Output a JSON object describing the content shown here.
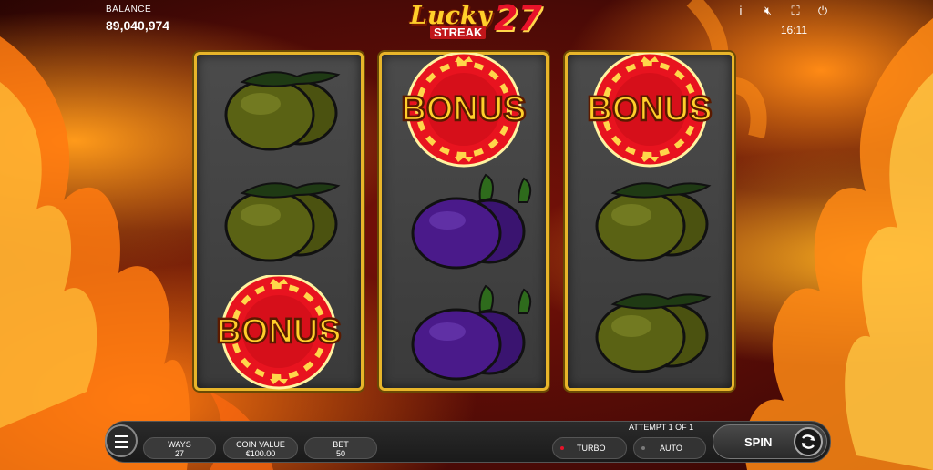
{
  "header": {
    "balance_label": "BALANCE",
    "balance_value": "89,040,974",
    "logo_word": "Lucky",
    "logo_sub": "STREAK",
    "logo_num": "27",
    "clock": "16:11"
  },
  "top_icons": [
    "info-icon",
    "mute-icon",
    "fullscreen-icon",
    "power-icon"
  ],
  "reels": [
    [
      "lemon",
      "lemon",
      "bonus"
    ],
    [
      "bonus",
      "plum",
      "plum"
    ],
    [
      "bonus",
      "lemon",
      "lemon"
    ]
  ],
  "bonus_text": "BONUS",
  "controls": {
    "ways_label": "WAYS",
    "ways_value": "27",
    "coin_label": "COIN VALUE",
    "coin_value": "€100.00",
    "bet_label": "BET",
    "bet_value": "50",
    "attempt": "ATTEMPT 1 OF 1",
    "turbo": "TURBO",
    "auto": "AUTO",
    "spin": "SPIN"
  },
  "colors": {
    "frame_gold": "#e8b52a",
    "bonus_red": "#e8131f",
    "turbo_dot": "#e8132a",
    "auto_dot": "#7a7a7a"
  }
}
